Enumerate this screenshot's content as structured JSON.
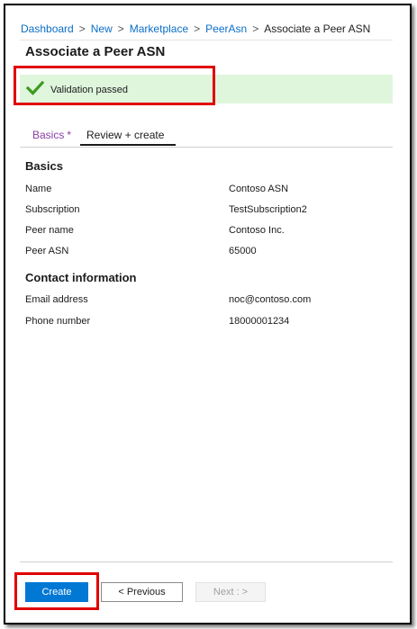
{
  "breadcrumb": {
    "items": [
      "Dashboard",
      "New",
      "Marketplace",
      "PeerAsn"
    ],
    "current": "Associate a Peer ASN",
    "separator": ">"
  },
  "page": {
    "title": "Associate a Peer ASN"
  },
  "validation": {
    "message": "Validation passed",
    "status_color": "#dff6dd",
    "icon": "checkmark-icon"
  },
  "tabs": [
    {
      "label": "Basics",
      "required_marker": "*"
    },
    {
      "label": "Review + create"
    }
  ],
  "basics": {
    "heading": "Basics",
    "fields": [
      {
        "label": "Name",
        "value": "Contoso ASN"
      },
      {
        "label": "Subscription",
        "value": "TestSubscription2"
      },
      {
        "label": "Peer name",
        "value": "Contoso Inc."
      },
      {
        "label": "Peer ASN",
        "value": "65000"
      }
    ]
  },
  "contact": {
    "heading": "Contact information",
    "fields": [
      {
        "label": "Email address",
        "value": "noc@contoso.com"
      },
      {
        "label": "Phone number",
        "value": "18000001234"
      }
    ]
  },
  "footer": {
    "create_label": "Create",
    "previous_label": "< Previous",
    "next_label": "Next : >"
  },
  "colors": {
    "accent": "#0078d4",
    "highlight": "#e00000",
    "tab_active": "#8a3fa6"
  }
}
